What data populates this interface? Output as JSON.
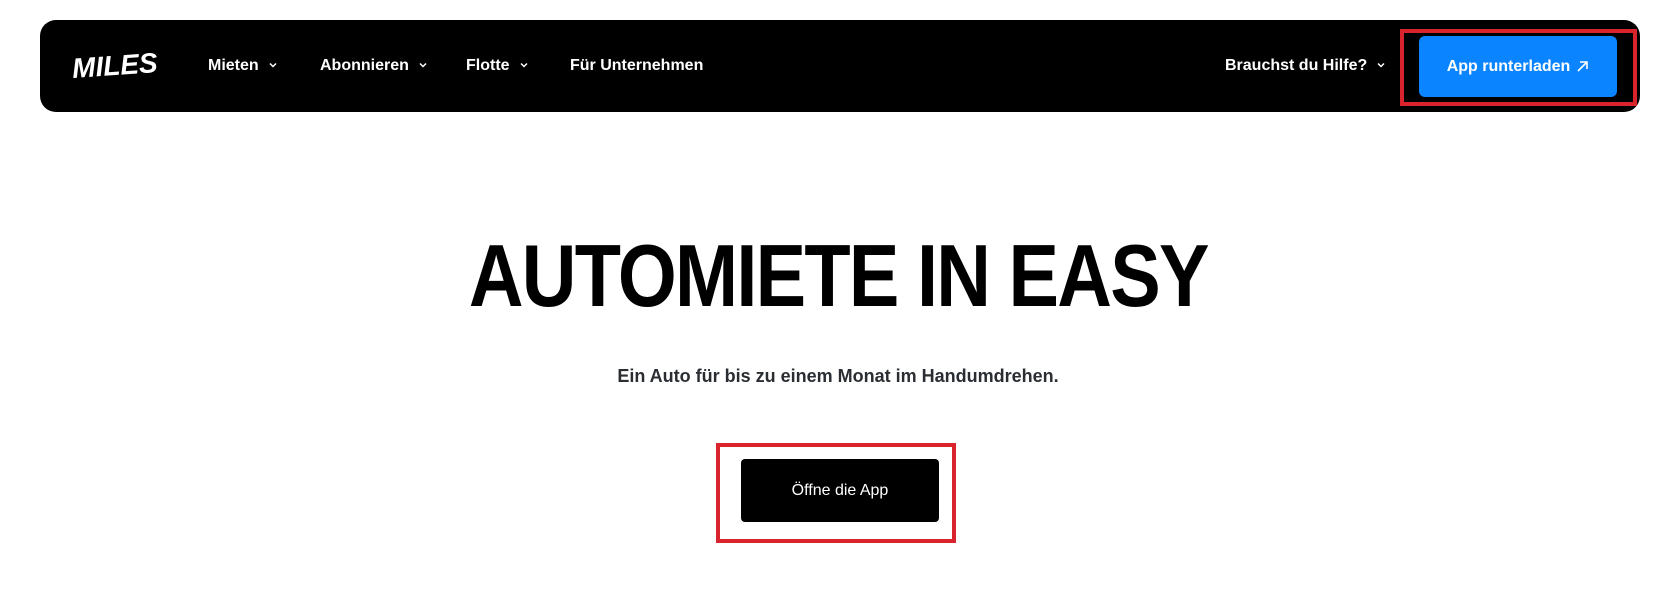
{
  "brand": {
    "logo_text": "MILES"
  },
  "nav": {
    "items": [
      {
        "label": "Mieten",
        "has_dropdown": true
      },
      {
        "label": "Abonnieren",
        "has_dropdown": true
      },
      {
        "label": "Flotte",
        "has_dropdown": true
      },
      {
        "label": "Für Unternehmen",
        "has_dropdown": false
      }
    ],
    "help_label": "Brauchst du Hilfe?",
    "download_button_label": "App runterladen"
  },
  "hero": {
    "title": "AUTOMIETE IN EASY",
    "subtitle": "Ein Auto für bis zu einem Monat im Handumdrehen.",
    "open_app_label": "Öffne die App"
  },
  "colors": {
    "navbar_bg": "#000000",
    "accent_blue": "#0b85ff",
    "highlight_red": "#d9232d",
    "text_dark": "#2a2e33"
  },
  "icons": [
    "chevron-down-icon",
    "arrow-up-right-icon"
  ]
}
